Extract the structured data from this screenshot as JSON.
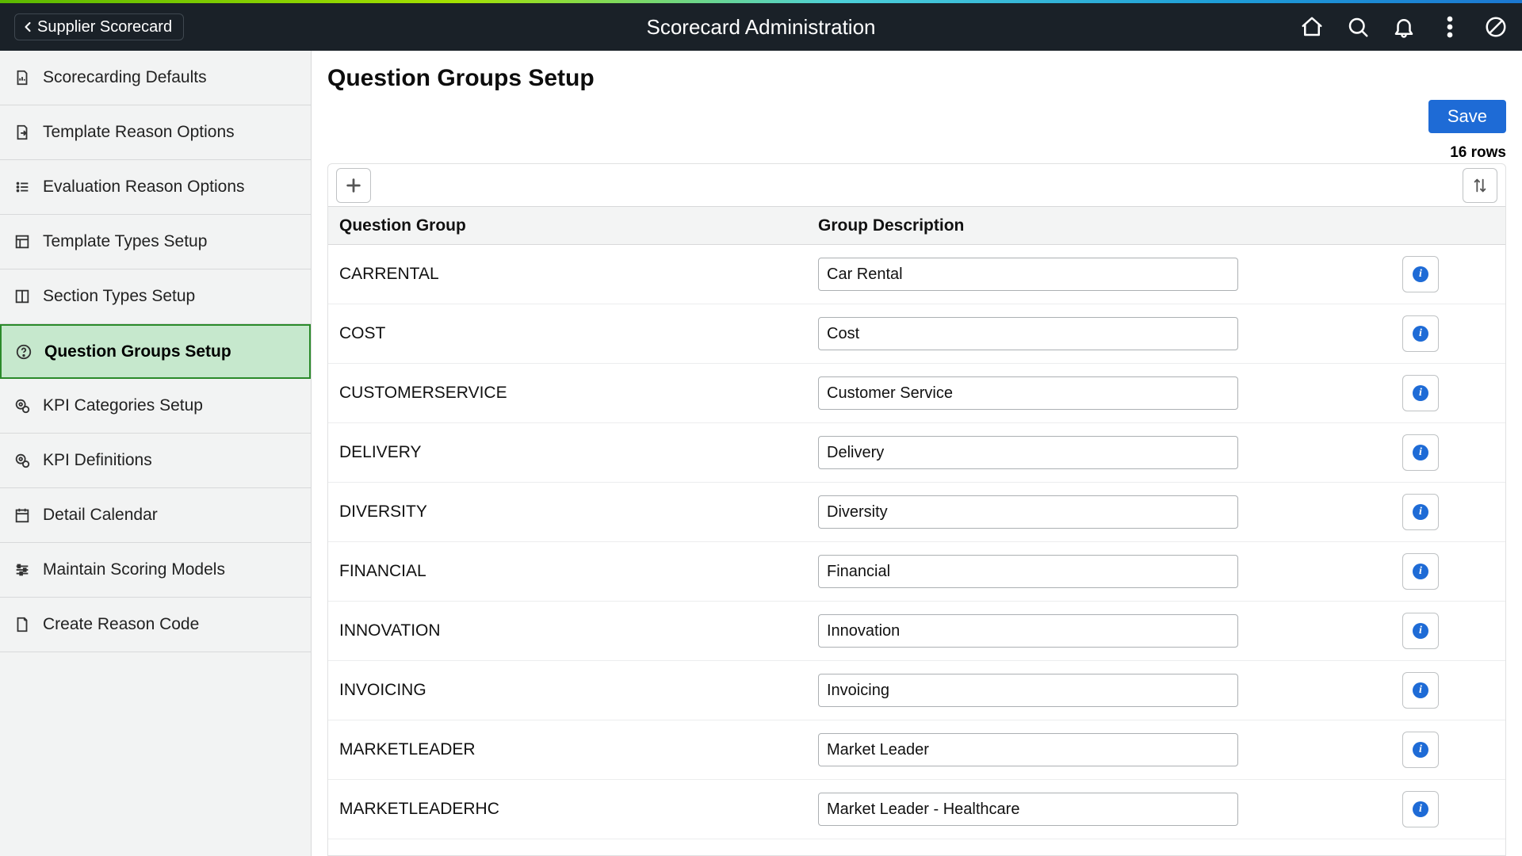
{
  "header": {
    "back_label": "Supplier Scorecard",
    "title": "Scorecard Administration"
  },
  "sidebar": {
    "items": [
      {
        "label": "Scorecarding Defaults"
      },
      {
        "label": "Template Reason Options"
      },
      {
        "label": "Evaluation Reason Options"
      },
      {
        "label": "Template Types Setup"
      },
      {
        "label": "Section Types Setup"
      },
      {
        "label": "Question Groups Setup"
      },
      {
        "label": "KPI Categories Setup"
      },
      {
        "label": "KPI Definitions"
      },
      {
        "label": "Detail Calendar"
      },
      {
        "label": "Maintain Scoring Models"
      },
      {
        "label": "Create Reason Code"
      }
    ],
    "active_index": 5
  },
  "page": {
    "title": "Question Groups Setup",
    "save_label": "Save",
    "rows_count": "16 rows",
    "columns": {
      "group": "Question Group",
      "desc": "Group Description"
    },
    "rows": [
      {
        "group": "CARRENTAL",
        "desc": "Car Rental"
      },
      {
        "group": "COST",
        "desc": "Cost"
      },
      {
        "group": "CUSTOMERSERVICE",
        "desc": "Customer Service"
      },
      {
        "group": "DELIVERY",
        "desc": "Delivery"
      },
      {
        "group": "DIVERSITY",
        "desc": "Diversity"
      },
      {
        "group": "FINANCIAL",
        "desc": "Financial"
      },
      {
        "group": "INNOVATION",
        "desc": "Innovation"
      },
      {
        "group": "INVOICING",
        "desc": "Invoicing"
      },
      {
        "group": "MARKETLEADER",
        "desc": "Market Leader"
      },
      {
        "group": "MARKETLEADERHC",
        "desc": "Market Leader - Healthcare"
      }
    ]
  }
}
